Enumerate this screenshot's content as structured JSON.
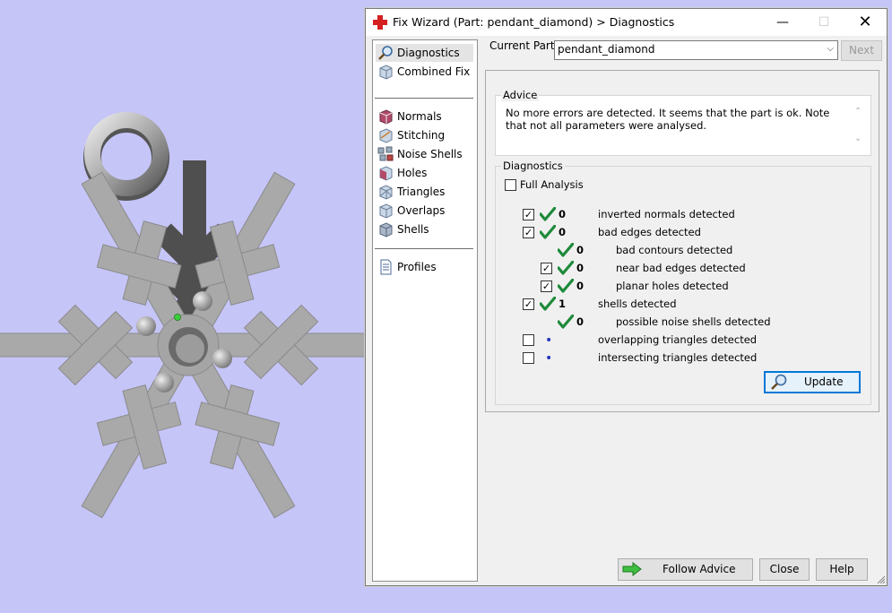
{
  "window": {
    "title": "Fix Wizard (Part: pendant_diamond) > Diagnostics",
    "buttons": {
      "minimize": "—",
      "maximize": "☐",
      "close": "✕"
    }
  },
  "nav": {
    "items": [
      {
        "label": "Diagnostics",
        "icon": "magnifier-icon",
        "selected": true
      },
      {
        "label": "Combined Fix",
        "icon": "cube-icon"
      },
      {
        "label": "Normals",
        "icon": "normals-cube-icon"
      },
      {
        "label": "Stitching",
        "icon": "stitching-cube-icon"
      },
      {
        "label": "Noise Shells",
        "icon": "noise-shells-icon"
      },
      {
        "label": "Holes",
        "icon": "holes-cube-icon"
      },
      {
        "label": "Triangles",
        "icon": "triangles-cube-icon"
      },
      {
        "label": "Overlaps",
        "icon": "overlaps-cube-icon"
      },
      {
        "label": "Shells",
        "icon": "shells-cube-icon"
      },
      {
        "label": "Profiles",
        "icon": "document-icon"
      }
    ]
  },
  "current_part": {
    "label": "Current Part:",
    "value": "pendant_diamond"
  },
  "next_label": "Next",
  "advice": {
    "title": "Advice",
    "text": "No more errors are detected. It seems that the part is ok. Note that not all parameters were analysed."
  },
  "diagnostics": {
    "title": "Diagnostics",
    "full_analysis": {
      "label": "Full Analysis",
      "checked": false
    },
    "rows": [
      {
        "checkbox": true,
        "checked": true,
        "status": "ok",
        "count": "0",
        "label": "inverted normals detected",
        "indent": 0
      },
      {
        "checkbox": true,
        "checked": true,
        "status": "ok",
        "count": "0",
        "label": "bad edges detected",
        "indent": 0
      },
      {
        "checkbox": false,
        "status": "ok",
        "count": "0",
        "label": "bad contours detected",
        "indent": 1
      },
      {
        "checkbox": true,
        "checked": true,
        "status": "ok",
        "count": "0",
        "label": "near bad edges detected",
        "indent": 1
      },
      {
        "checkbox": true,
        "checked": true,
        "status": "ok",
        "count": "0",
        "label": "planar holes detected",
        "indent": 1
      },
      {
        "checkbox": true,
        "checked": true,
        "status": "ok",
        "count": "1",
        "label": "shells detected",
        "indent": 0
      },
      {
        "checkbox": false,
        "status": "ok",
        "count": "0",
        "label": "possible noise shells detected",
        "indent": 1
      },
      {
        "checkbox": true,
        "checked": false,
        "status": "none",
        "count": "",
        "label": "overlapping triangles detected",
        "indent": 0
      },
      {
        "checkbox": true,
        "checked": false,
        "status": "none",
        "count": "",
        "label": "intersecting triangles detected",
        "indent": 0
      }
    ],
    "update_label": "Update"
  },
  "footer": {
    "follow_advice": "Follow Advice",
    "close": "Close",
    "help": "Help"
  },
  "colors": {
    "viewport_bg": "#c5c5f8",
    "check_green": "#1e8a3a",
    "accent_blue": "#0078d7"
  }
}
